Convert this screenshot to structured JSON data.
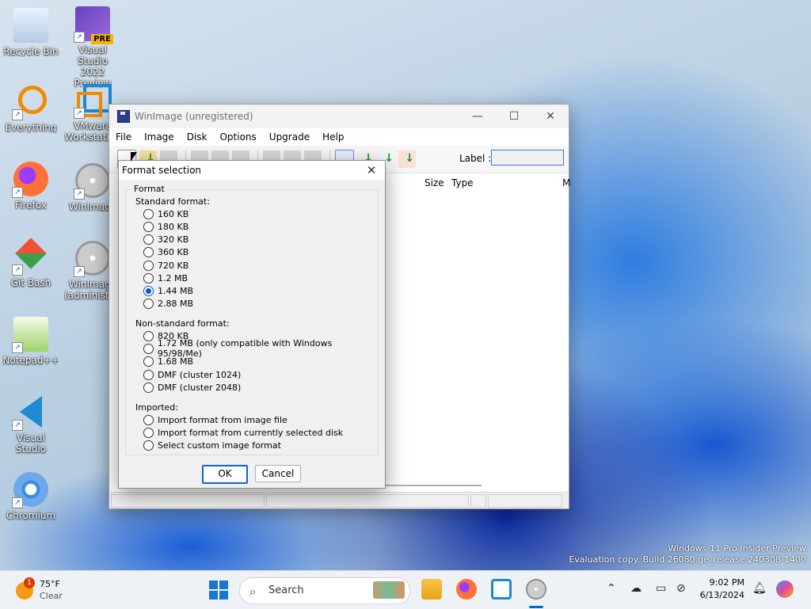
{
  "desktop": {
    "icons": [
      {
        "label": "Recycle Bin"
      },
      {
        "label": "Visual Studio 2022 Preview",
        "badge": "PRE"
      },
      {
        "label": "Everything"
      },
      {
        "label": "VMware Workstation"
      },
      {
        "label": "Firefox"
      },
      {
        "label": "WinImage"
      },
      {
        "label": "Git Bash"
      },
      {
        "label": "WinImage (administrator)"
      },
      {
        "label": "Notepad++"
      },
      {
        "label": "Visual Studio Code"
      },
      {
        "label": "Chromium"
      }
    ]
  },
  "main_window": {
    "title": "WinImage (unregistered)",
    "controls": {
      "minimize": "—",
      "maximize": "☐",
      "close": "✕"
    },
    "menu": [
      "File",
      "Image",
      "Disk",
      "Options",
      "Upgrade",
      "Help"
    ],
    "toolbar": {
      "label_text": "Label :",
      "label_value": ""
    },
    "columns": [
      "Size",
      "Type",
      "M"
    ]
  },
  "dialog": {
    "title": "Format selection",
    "close": "✕",
    "group_title": "Format",
    "standard_title": "Standard format:",
    "standard": [
      "160 KB",
      "180 KB",
      "320 KB",
      "360 KB",
      "720 KB",
      "1.2 MB",
      "1.44 MB",
      "2.88 MB"
    ],
    "standard_selected": "1.44 MB",
    "nonstandard_title": "Non-standard format:",
    "nonstandard": [
      "820 KB",
      "1.72 MB (only compatible with Windows 95/98/Me)",
      "1.68 MB",
      "DMF (cluster 1024)",
      "DMF (cluster 2048)"
    ],
    "imported_title": "Imported:",
    "imported": [
      "Import format from image file",
      "Import format from currently selected disk",
      "Select custom image format"
    ],
    "ok": "OK",
    "cancel": "Cancel"
  },
  "watermark": {
    "line1": "Windows 11 Pro Insider Preview",
    "line2": "Evaluation copy. Build 26080.ge_release.240308-1400"
  },
  "taskbar": {
    "weather": {
      "temp": "75°F",
      "condition": "Clear",
      "badge": "1"
    },
    "search": "Search",
    "clock": {
      "time": "9:02 PM",
      "date": "6/13/2024"
    }
  }
}
